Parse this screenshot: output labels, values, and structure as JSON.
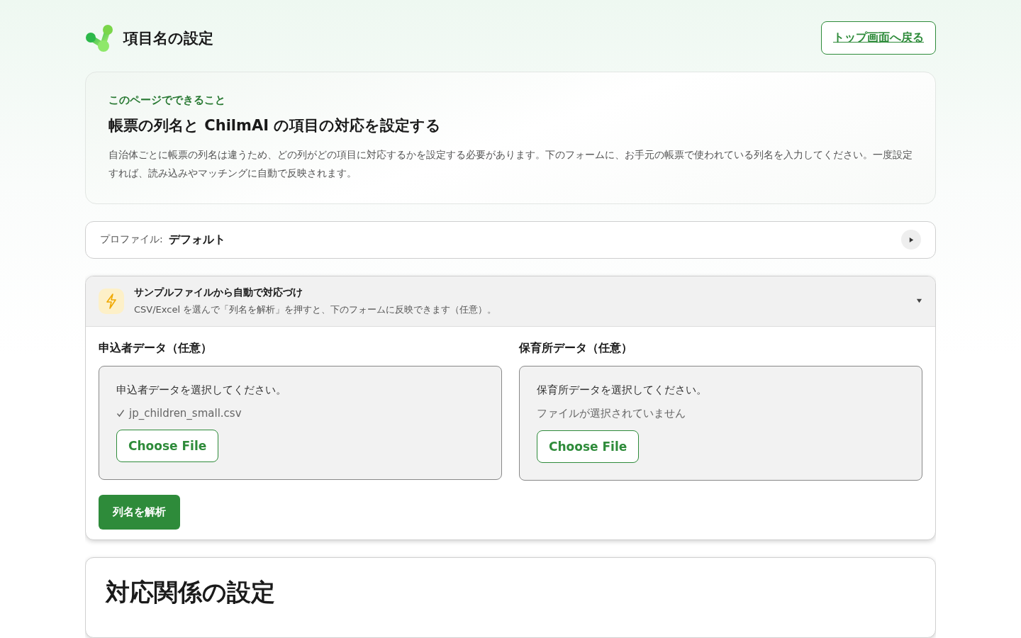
{
  "header": {
    "title": "項目名の設定",
    "back_link": "トップ画面へ戻る"
  },
  "intro": {
    "eyebrow": "このページでできること",
    "heading": "帳票の列名と ChilmAI の項目の対応を設定する",
    "body": "自治体ごとに帳票の列名は違うため、どの列がどの項目に対応するかを設定する必要があります。下のフォームに、お手元の帳票で使われている列名を入力してください。一度設定すれば、読み込みやマッチングに自動で反映されます。"
  },
  "profile": {
    "label": "プロファイル:",
    "value": "デフォルト",
    "expanded": false
  },
  "sample": {
    "title": "サンプルファイルから自動で対応づけ",
    "subtitle": "CSV/Excel を選んで「列名を解析」を押すと、下のフォームに反映できます（任意）。",
    "expanded": true,
    "files": [
      {
        "label": "申込者データ（任意）",
        "prompt": "申込者データを選択してください。",
        "file_chosen": true,
        "status": "jp_children_small.csv",
        "button": "Choose File"
      },
      {
        "label": "保育所データ（任意）",
        "prompt": "保育所データを選択してください。",
        "file_chosen": false,
        "status": "ファイルが選択されていません",
        "button": "Choose File"
      }
    ],
    "parse_button": "列名を解析"
  },
  "mapping": {
    "heading": "対応関係の設定"
  }
}
